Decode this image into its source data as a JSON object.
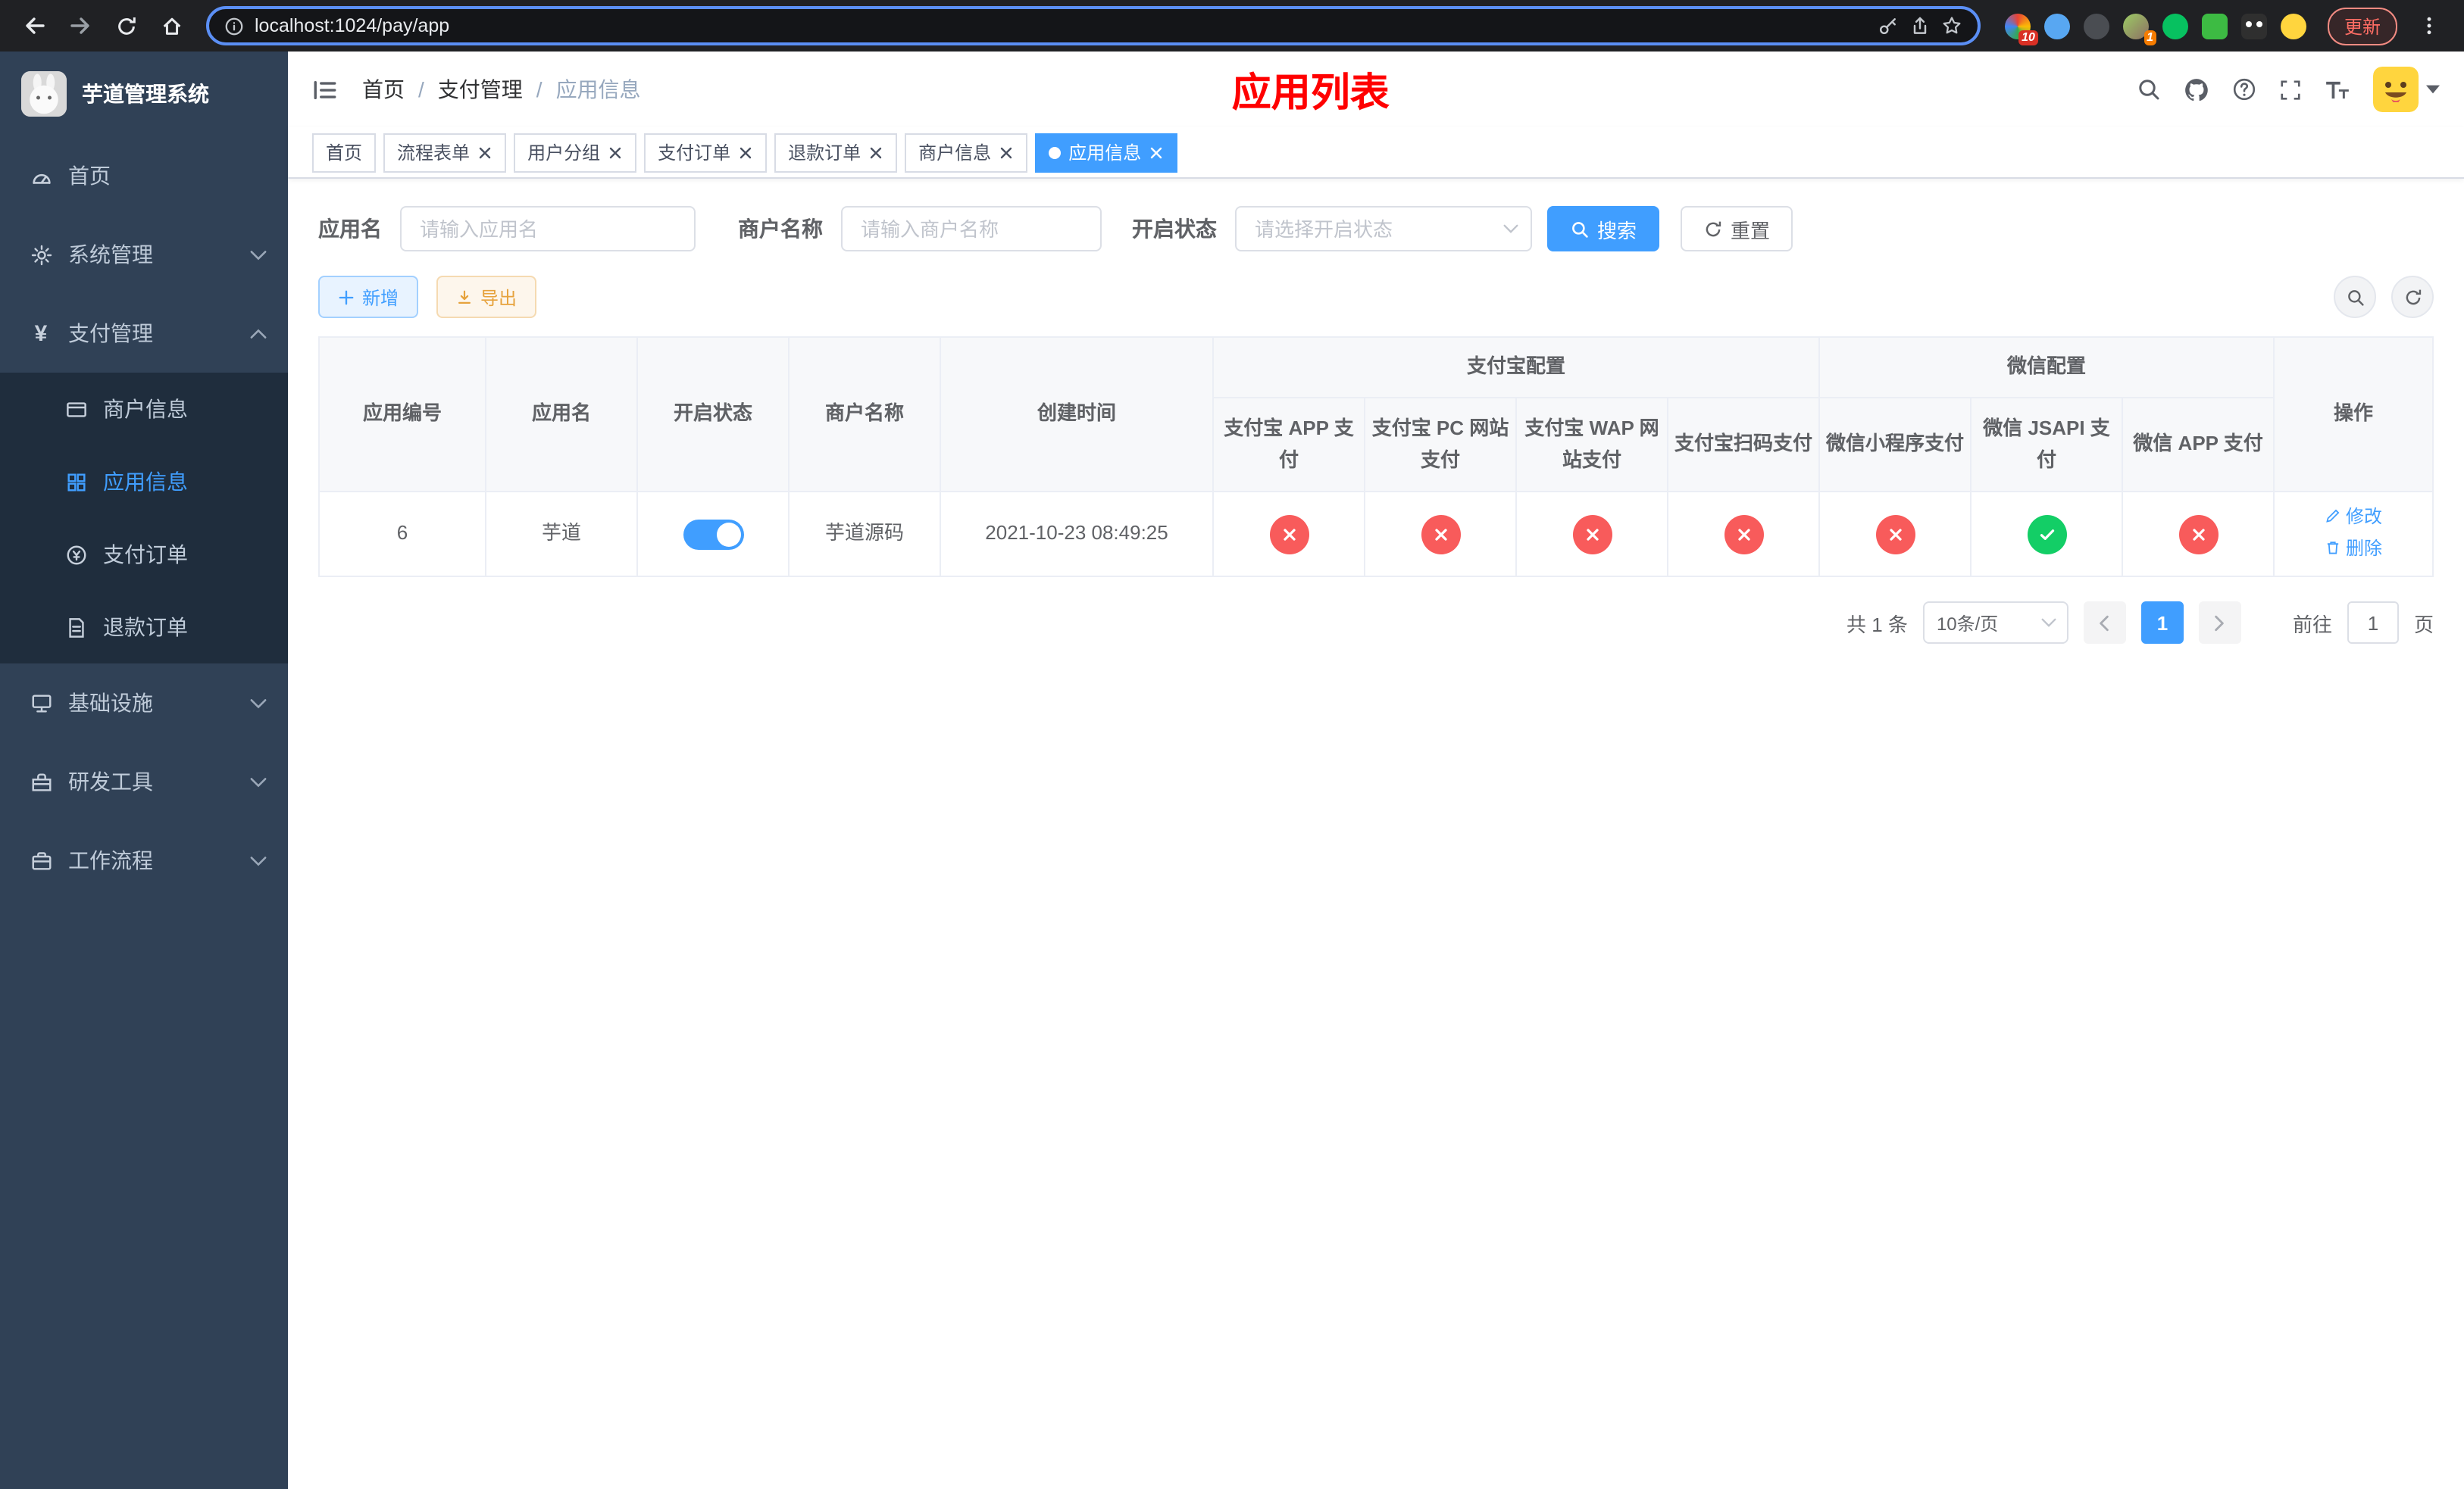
{
  "browser": {
    "url": "localhost:1024/pay/app",
    "update_label": "更新",
    "extensions": [
      {
        "name": "grid-extension",
        "badge": "10"
      },
      {
        "name": "blue-extension"
      },
      {
        "name": "dark-extension"
      },
      {
        "name": "avatar-extension",
        "badge": "1"
      },
      {
        "name": "wechat-devtools-extension"
      },
      {
        "name": "chat-extension"
      },
      {
        "name": "tampermonkey-extension"
      },
      {
        "name": "emoji-extension"
      }
    ]
  },
  "sidebar": {
    "app_title": "芋道管理系统",
    "home": "首页",
    "system": "系统管理",
    "payment": "支付管理",
    "payment_children": [
      "商户信息",
      "应用信息",
      "支付订单",
      "退款订单"
    ],
    "infrastructure": "基础设施",
    "devtools": "研发工具",
    "workflow": "工作流程"
  },
  "header": {
    "breadcrumb": [
      "首页",
      "支付管理",
      "应用信息"
    ],
    "page_title": "应用列表"
  },
  "tabs": [
    "首页",
    "流程表单",
    "用户分组",
    "支付订单",
    "退款订单",
    "商户信息",
    "应用信息"
  ],
  "filters": {
    "app_name_label": "应用名",
    "app_name_placeholder": "请输入应用名",
    "merchant_label": "商户名称",
    "merchant_placeholder": "请输入商户名称",
    "status_label": "开启状态",
    "status_placeholder": "请选择开启状态",
    "search_label": "搜索",
    "reset_label": "重置"
  },
  "toolbar": {
    "add_label": "新增",
    "export_label": "导出"
  },
  "table": {
    "headers": {
      "app_id": "应用编号",
      "app_name": "应用名",
      "status": "开启状态",
      "merchant": "商户名称",
      "create_time": "创建时间",
      "alipay_group": "支付宝配置",
      "alipay": [
        "支付宝 APP 支付",
        "支付宝 PC 网站支付",
        "支付宝 WAP 网站支付",
        "支付宝扫码支付"
      ],
      "wechat_group": "微信配置",
      "wechat": [
        "微信小程序支付",
        "微信 JSAPI 支付",
        "微信 APP 支付"
      ],
      "actions": "操作"
    },
    "rows": [
      {
        "app_id": "6",
        "app_name": "芋道",
        "enabled": true,
        "merchant": "芋道源码",
        "create_time": "2021-10-23 08:49:25",
        "alipay": [
          false,
          false,
          false,
          false
        ],
        "wechat": [
          false,
          true,
          false
        ],
        "edit_label": "修改",
        "delete_label": "删除"
      }
    ]
  },
  "pagination": {
    "total": "共 1 条",
    "page_size": "10条/页",
    "page": "1",
    "goto_label": "前往",
    "goto_value": "1",
    "unit_label": "页"
  },
  "colors": {
    "accent": "#409eff",
    "success": "#13ce66",
    "danger": "#f85b5b",
    "warning": "#e6a23c",
    "page_title_red": "#ff0000",
    "sidebar_bg": "#304156",
    "sidebar_sub_bg": "#1f2d3d"
  }
}
